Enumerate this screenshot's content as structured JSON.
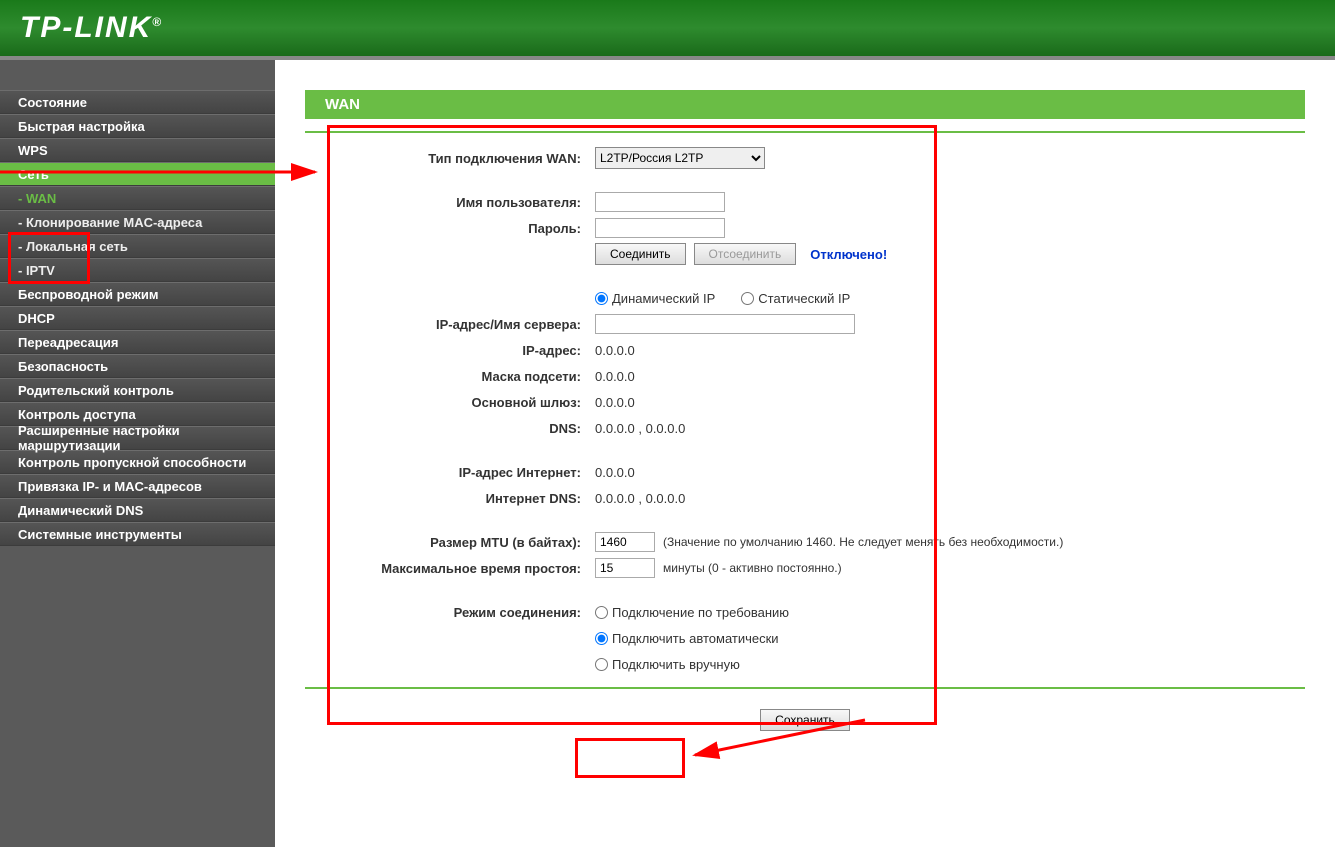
{
  "header": {
    "logo": "TP-LINK"
  },
  "sidebar": {
    "items": [
      {
        "label": "Состояние",
        "type": "item"
      },
      {
        "label": "Быстрая настройка",
        "type": "item"
      },
      {
        "label": "WPS",
        "type": "item"
      },
      {
        "label": "Сеть",
        "type": "parent-active"
      },
      {
        "label": "- WAN",
        "type": "sub-active"
      },
      {
        "label": "- Клонирование MAC-адреса",
        "type": "sub"
      },
      {
        "label": "- Локальная сеть",
        "type": "sub"
      },
      {
        "label": "- IPTV",
        "type": "sub"
      },
      {
        "label": "Беспроводной режим",
        "type": "item"
      },
      {
        "label": "DHCP",
        "type": "item"
      },
      {
        "label": "Переадресация",
        "type": "item"
      },
      {
        "label": "Безопасность",
        "type": "item"
      },
      {
        "label": "Родительский контроль",
        "type": "item"
      },
      {
        "label": "Контроль доступа",
        "type": "item"
      },
      {
        "label": "Расширенные настройки маршрутизации",
        "type": "item"
      },
      {
        "label": "Контроль пропускной способности",
        "type": "item"
      },
      {
        "label": "Привязка IP- и MAC-адресов",
        "type": "item"
      },
      {
        "label": "Динамический DNS",
        "type": "item"
      },
      {
        "label": "Системные инструменты",
        "type": "item"
      }
    ]
  },
  "page": {
    "title": "WAN",
    "labels": {
      "wan_type": "Тип подключения WAN:",
      "username": "Имя пользователя:",
      "password": "Пароль:",
      "connect": "Соединить",
      "disconnect": "Отсоединить",
      "status": "Отключено!",
      "dyn_ip": "Динамический IP",
      "stat_ip": "Статический IP",
      "server": "IP-адрес/Имя сервера:",
      "ip": "IP-адрес:",
      "mask": "Маска подсети:",
      "gateway": "Основной шлюз:",
      "dns": "DNS:",
      "inet_ip": "IP-адрес Интернет:",
      "inet_dns": "Интернет DNS:",
      "mtu": "Размер MTU (в байтах):",
      "mtu_hint": "(Значение по умолчанию 1460. Не следует менять без необходимости.)",
      "idle": "Максимальное время простоя:",
      "idle_hint": "минуты (0 - активно постоянно.)",
      "conn_mode": "Режим соединения:",
      "mode_demand": "Подключение по требованию",
      "mode_auto": "Подключить автоматически",
      "mode_manual": "Подключить вручную",
      "save": "Сохранить"
    },
    "values": {
      "wan_type_selected": "L2TP/Россия L2TP",
      "username": "",
      "password": "",
      "server": "",
      "ip": "0.0.0.0",
      "mask": "0.0.0.0",
      "gateway": "0.0.0.0",
      "dns": "0.0.0.0 , 0.0.0.0",
      "inet_ip": "0.0.0.0",
      "inet_dns": "0.0.0.0 , 0.0.0.0",
      "mtu": "1460",
      "idle": "15",
      "ip_mode": "dynamic",
      "conn_mode": "auto"
    }
  }
}
